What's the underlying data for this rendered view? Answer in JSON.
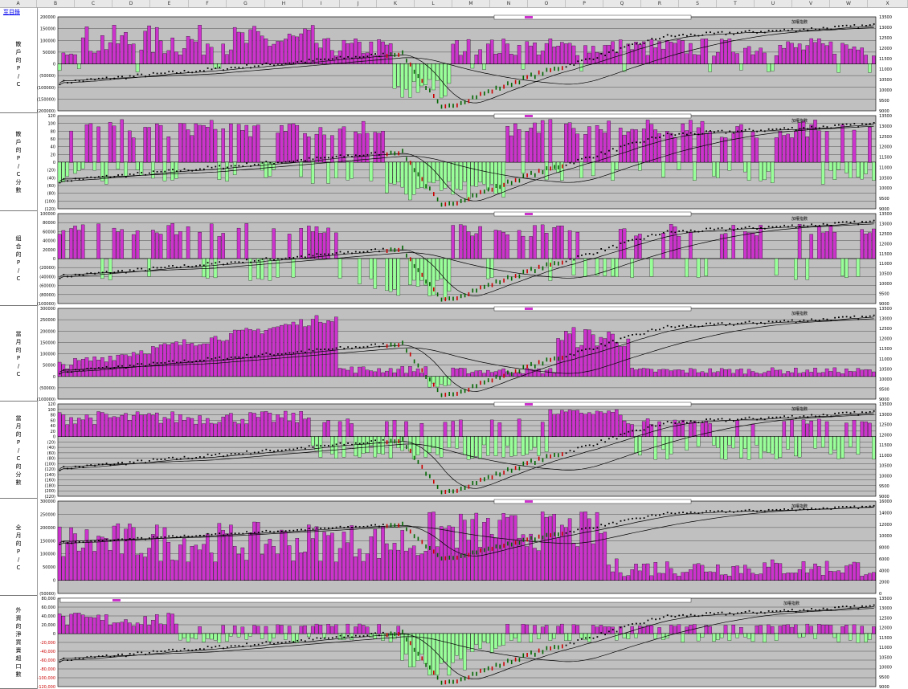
{
  "sheet": {
    "link_label": "至目錄",
    "columns": [
      "A",
      "B",
      "C",
      "D",
      "E",
      "F",
      "G",
      "H",
      "I",
      "J",
      "K",
      "L",
      "M",
      "N",
      "O",
      "P",
      "Q",
      "R",
      "S",
      "T",
      "U",
      "V",
      "W",
      "X"
    ]
  },
  "colors": {
    "positive_bar": "#cc33cc",
    "negative_bar": "#99ff99",
    "plot_bg": "#c0c0c0",
    "price_dots": "#000000",
    "down_candle": "#cc0000",
    "up_candle": "#006600"
  },
  "panels": [
    {
      "row_label": "散戶的P/C",
      "left_ticks": [
        "200000",
        "150000",
        "100000",
        "50000",
        "0",
        "(50000)",
        "(100000)",
        "(150000)",
        "(200000)"
      ],
      "right_ticks": [
        "13500",
        "13000",
        "12500",
        "12000",
        "11500",
        "11000",
        "10500",
        "10000",
        "9500",
        "9000"
      ],
      "price_label": "加權指數"
    },
    {
      "row_label": "散戶的P/C分數",
      "left_ticks": [
        "120",
        "100",
        "80",
        "60",
        "40",
        "20",
        "0",
        "(20)",
        "(40)",
        "(60)",
        "(80)",
        "(100)",
        "(120)"
      ],
      "right_ticks": [
        "13500",
        "13000",
        "12500",
        "12000",
        "11500",
        "11000",
        "10500",
        "10000",
        "9500",
        "9000"
      ],
      "price_label": "加權指數"
    },
    {
      "row_label": "組合的P/C",
      "left_ticks": [
        "100000",
        "80000",
        "60000",
        "40000",
        "20000",
        "0",
        "(20000)",
        "(40000)",
        "(60000)",
        "(80000)",
        "(100000)"
      ],
      "right_ticks": [
        "13500",
        "13000",
        "12500",
        "12000",
        "11500",
        "11000",
        "10500",
        "10000",
        "9500",
        "9000"
      ],
      "price_label": "加權指數"
    },
    {
      "row_label": "當月的P/C",
      "left_ticks": [
        "300000",
        "250000",
        "200000",
        "150000",
        "100000",
        "50000",
        "0",
        "(50000)",
        "(100000)"
      ],
      "right_ticks": [
        "13500",
        "13000",
        "12500",
        "12000",
        "11500",
        "11000",
        "10500",
        "10000",
        "9500",
        "9000"
      ],
      "price_label": "加權指數"
    },
    {
      "row_label": "當月的P/C的分數",
      "left_ticks": [
        "120",
        "100",
        "80",
        "60",
        "40",
        "20",
        "0",
        "(20)",
        "(40)",
        "(60)",
        "(80)",
        "(100)",
        "(120)",
        "(140)",
        "(160)",
        "(180)",
        "(200)",
        "(220)"
      ],
      "right_ticks": [
        "13500",
        "13000",
        "12500",
        "12000",
        "11500",
        "11000",
        "10500",
        "10000",
        "9500",
        "9000"
      ],
      "price_label": "加權指數"
    },
    {
      "row_label": "全月的P/C",
      "left_ticks": [
        "300000",
        "250000",
        "200000",
        "150000",
        "100000",
        "50000",
        "0",
        "(50000)"
      ],
      "right_ticks": [
        "16000",
        "14000",
        "12000",
        "10000",
        "8000",
        "6000",
        "4000",
        "2000",
        "0"
      ],
      "price_label": "加權指數"
    },
    {
      "row_label": "外資的淨買賣超口數",
      "left_ticks": [
        "80,000",
        "60,000",
        "40,000",
        "20,000",
        "0",
        "-20,000",
        "-40,000",
        "-60,000",
        "-80,000",
        "-100,000",
        "-120,000"
      ],
      "right_ticks": [
        "13500",
        "13000",
        "12500",
        "12000",
        "11500",
        "11000",
        "10500",
        "10000",
        "9500",
        "9000"
      ],
      "price_label": "加權指數"
    }
  ]
}
